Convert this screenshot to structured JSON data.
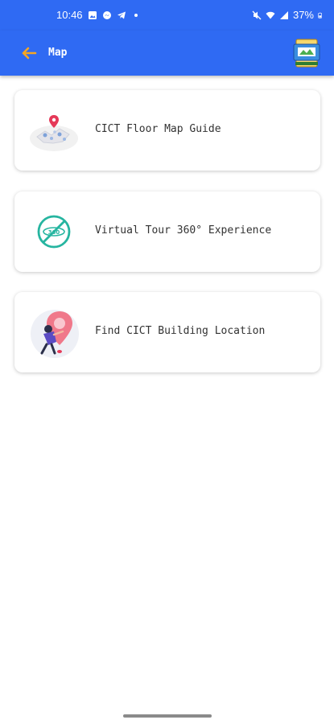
{
  "status_bar": {
    "time": "10:46",
    "battery": "37%",
    "left_icons": [
      "gallery-icon",
      "messenger-icon",
      "telegram-icon",
      "dot-icon"
    ],
    "right_icons": [
      "mute-icon",
      "wifi-icon",
      "signal-icon",
      "battery-icon"
    ]
  },
  "app_bar": {
    "title": "Map",
    "back_icon": "arrow-left-icon",
    "logo": "cict-logo-icon",
    "background": "#2f6af3",
    "back_color": "#f5a623"
  },
  "cards": [
    {
      "label": "CICT Floor Map Guide",
      "icon": "floor-map-icon"
    },
    {
      "label": "Virtual Tour 360° Experience",
      "icon": "tour-360-icon"
    },
    {
      "label": "Find CICT Building Location",
      "icon": "location-pin-icon"
    }
  ]
}
